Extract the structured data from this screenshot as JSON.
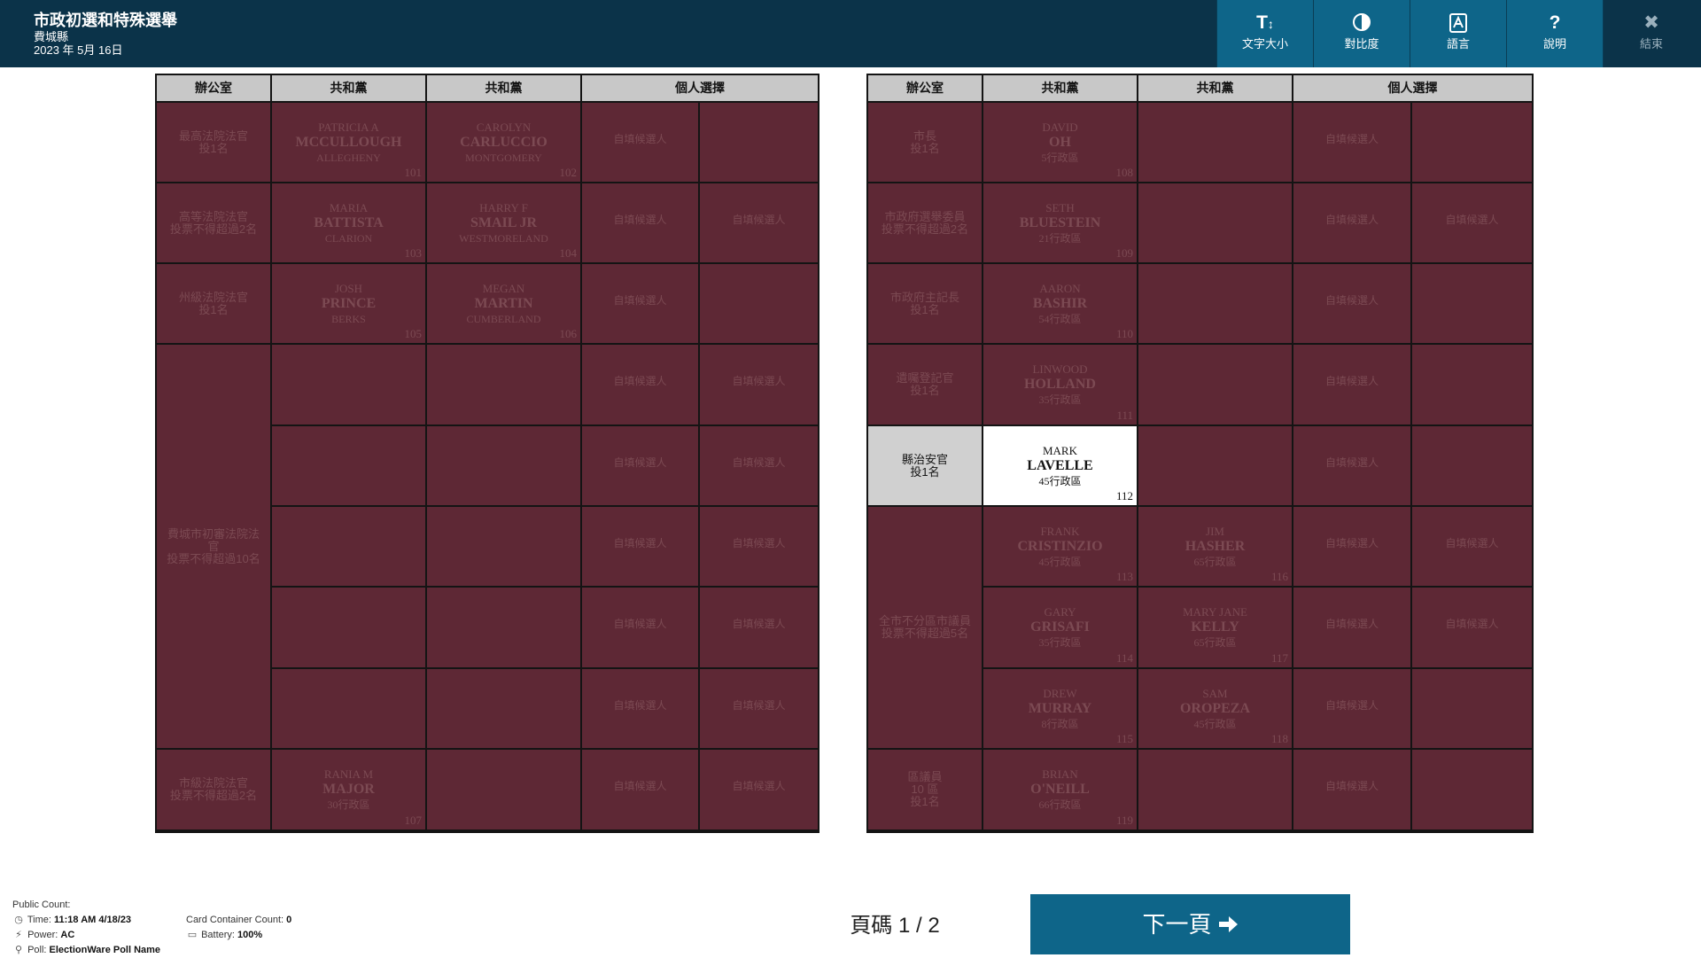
{
  "header": {
    "title": "市政初選和特殊選舉",
    "county": "費城縣",
    "date": "2023 年 5月 16日"
  },
  "toolbar": [
    {
      "icon": "text-size-icon",
      "glyph": "T",
      "label": "文字大小"
    },
    {
      "icon": "contrast-icon",
      "glyph": "",
      "label": "對比度"
    },
    {
      "icon": "language-icon",
      "glyph": "",
      "label": "語言"
    },
    {
      "icon": "help-icon",
      "glyph": "?",
      "label": "說明"
    },
    {
      "icon": "close-icon",
      "glyph": "✖",
      "label": "結束"
    }
  ],
  "columns": {
    "office": "辦公室",
    "party": "共和黨",
    "write_in_header": "個人選擇",
    "write_in": "自填候選人"
  },
  "left": {
    "offices": [
      {
        "name": "最高法院法官",
        "vote": "投1名"
      },
      {
        "name": "高等法院法官",
        "vote": "投票不得超過2名"
      },
      {
        "name": "州級法院法官",
        "vote": "投1名"
      },
      {
        "name": "費城市初審法院法官",
        "vote": "投票不得超過10名"
      },
      {
        "name": "市級法院法官",
        "vote": "投票不得超過2名"
      }
    ],
    "candidates": [
      {
        "first": "PATRICIA A",
        "last": "MCCULLOUGH",
        "loc": "ALLEGHENY",
        "num": "101"
      },
      {
        "first": "CAROLYN",
        "last": "CARLUCCIO",
        "loc": "MONTGOMERY",
        "num": "102"
      },
      {
        "first": "MARIA",
        "last": "BATTISTA",
        "loc": "CLARION",
        "num": "103"
      },
      {
        "first": "HARRY F",
        "last": "SMAIL JR",
        "loc": "WESTMORELAND",
        "num": "104"
      },
      {
        "first": "JOSH",
        "last": "PRINCE",
        "loc": "BERKS",
        "num": "105"
      },
      {
        "first": "MEGAN",
        "last": "MARTIN",
        "loc": "CUMBERLAND",
        "num": "106"
      },
      {
        "first": "RANIA M",
        "last": "MAJOR",
        "loc": "30行政區",
        "num": "107"
      }
    ]
  },
  "right": {
    "offices": [
      {
        "name": "市長",
        "vote": "投1名"
      },
      {
        "name": "市政府選舉委員",
        "vote": "投票不得超過2名"
      },
      {
        "name": "市政府主記長",
        "vote": "投1名"
      },
      {
        "name": "遺囑登記官",
        "vote": "投1名"
      },
      {
        "name": "縣治安官",
        "vote": "投1名"
      },
      {
        "name": "全市不分區市議員",
        "vote": "投票不得超過5名"
      },
      {
        "name": "區議員",
        "district": "10 區",
        "vote": "投1名"
      }
    ],
    "candidates": [
      {
        "first": "DAVID",
        "last": "OH",
        "loc": "5行政區",
        "num": "108"
      },
      {
        "first": "SETH",
        "last": "BLUESTEIN",
        "loc": "21行政區",
        "num": "109"
      },
      {
        "first": "AARON",
        "last": "BASHIR",
        "loc": "54行政區",
        "num": "110"
      },
      {
        "first": "LINWOOD",
        "last": "HOLLAND",
        "loc": "35行政區",
        "num": "111"
      },
      {
        "first": "MARK",
        "last": "LAVELLE",
        "loc": "45行政區",
        "num": "112"
      },
      {
        "first": "FRANK",
        "last": "CRISTINZIO",
        "loc": "45行政區",
        "num": "113"
      },
      {
        "first": "GARY",
        "last": "GRISAFI",
        "loc": "35行政區",
        "num": "114"
      },
      {
        "first": "DREW",
        "last": "MURRAY",
        "loc": "8行政區",
        "num": "115"
      },
      {
        "first": "JIM",
        "last": "HASHER",
        "loc": "65行政區",
        "num": "116"
      },
      {
        "first": "MARY JANE",
        "last": "KELLY",
        "loc": "65行政區",
        "num": "117"
      },
      {
        "first": "SAM",
        "last": "OROPEZA",
        "loc": "45行政區",
        "num": "118"
      },
      {
        "first": "BRIAN",
        "last": "O'NEILL",
        "loc": "66行政區",
        "num": "119"
      }
    ]
  },
  "footer": {
    "public_count_label": "Public Count:",
    "time_label": "Time:",
    "time_value": "11:18 AM 4/18/23",
    "power_label": "Power:",
    "power_value": "AC",
    "poll_label": "Poll:",
    "poll_value": "ElectionWare Poll Name",
    "card_label": "Card Container Count:",
    "card_value": "0",
    "battery_label": "Battery:",
    "battery_value": "100%"
  },
  "pager": {
    "page_text": "頁碼 1 / 2",
    "next_label": "下一頁"
  },
  "colors": {
    "header_bg": "#0b3349",
    "button_bg": "#0e6589",
    "cell_bg": "#5e2835",
    "selected_bg": "#ffffff"
  }
}
